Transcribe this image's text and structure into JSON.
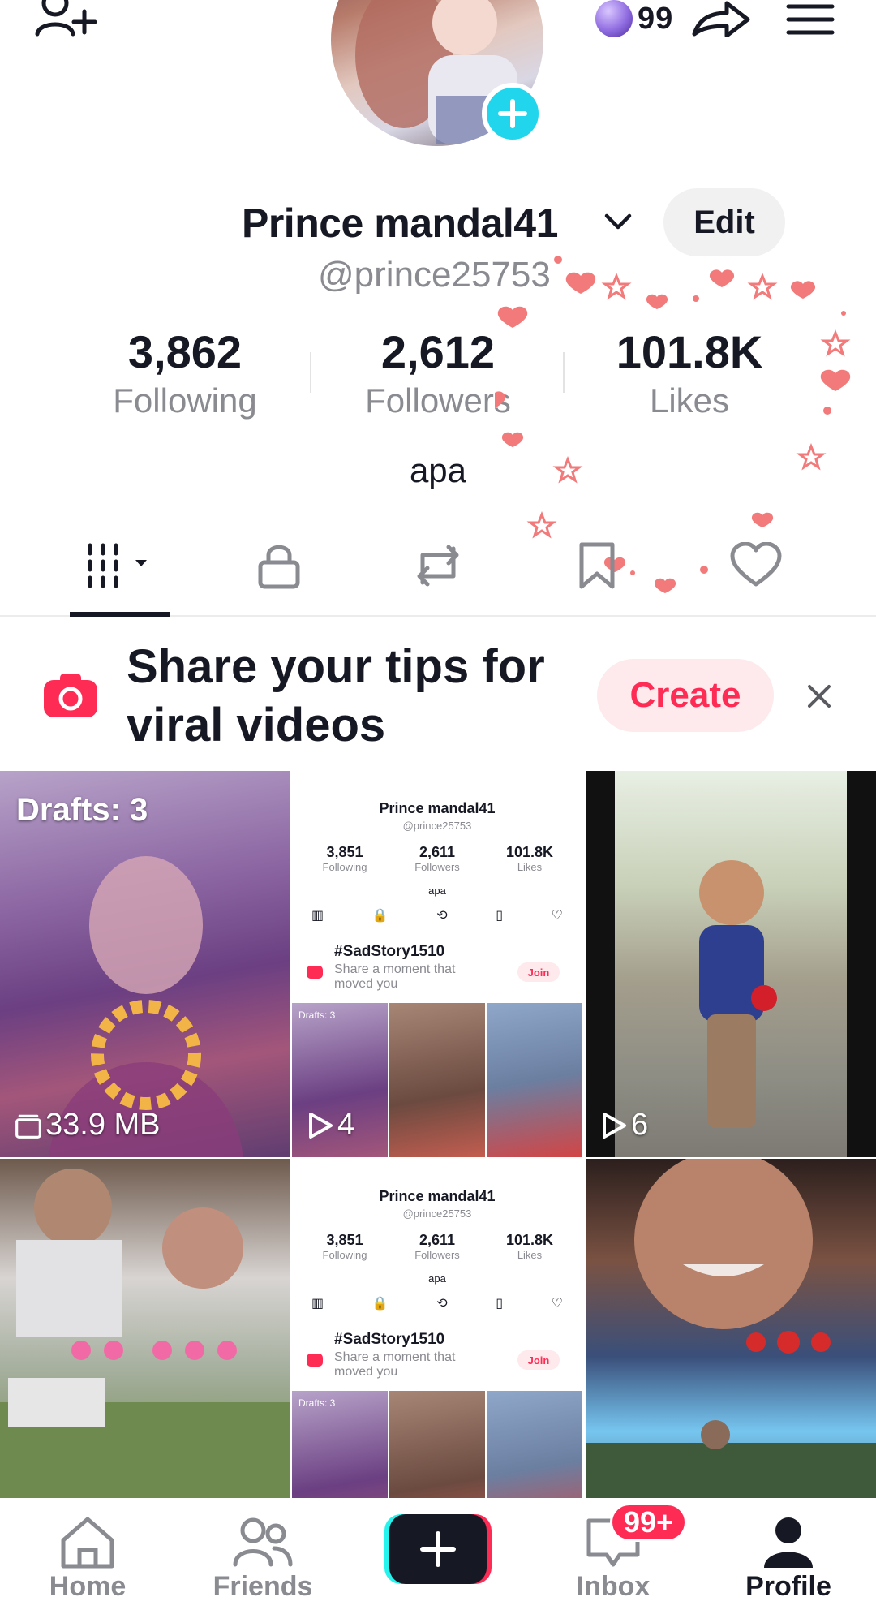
{
  "header": {
    "coins": "99",
    "icons": [
      "add-friend-icon",
      "coin-icon",
      "share-icon",
      "menu-icon"
    ]
  },
  "profile": {
    "display_name": "Prince mandal41",
    "edit_label": "Edit",
    "username": "@prince25753",
    "bio": "apa",
    "stats": [
      {
        "value": "3,862",
        "label": "Following"
      },
      {
        "value": "2,612",
        "label": "Followers"
      },
      {
        "value": "101.8K",
        "label": "Likes"
      }
    ]
  },
  "tabs": [
    {
      "name": "videos",
      "icon": "grid-icon",
      "active": true
    },
    {
      "name": "private",
      "icon": "lock-icon",
      "active": false
    },
    {
      "name": "reposts",
      "icon": "repost-icon",
      "active": false
    },
    {
      "name": "favorites",
      "icon": "bookmark-icon",
      "active": false
    },
    {
      "name": "liked",
      "icon": "heart-icon",
      "active": false
    }
  ],
  "promo": {
    "text": "Share your tips for viral videos",
    "button": "Create"
  },
  "grid": {
    "drafts_label": "Drafts: 3",
    "drafts_size": "33.9 MB",
    "tile2_views": "4",
    "tile3_views": "6",
    "mini_profile": {
      "name": "Prince mandal41",
      "user": "@prince25753",
      "following": "3,851",
      "following_label": "Following",
      "followers": "2,611",
      "followers_label": "Followers",
      "likes": "101.8K",
      "likes_label": "Likes",
      "bio": "apa",
      "hashtag": "#SadStory1510",
      "sub": "Share a moment that moved you",
      "join": "Join",
      "drafts": "Drafts: 3"
    }
  },
  "bottom_nav": {
    "home": "Home",
    "friends": "Friends",
    "inbox": "Inbox",
    "inbox_badge": "99+",
    "profile": "Profile"
  },
  "colors": {
    "accent": "#fe2c55",
    "cyan": "#25f4ee",
    "text": "#161823",
    "muted": "#8a8b91"
  }
}
